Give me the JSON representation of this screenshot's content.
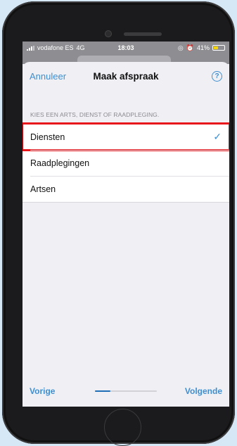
{
  "status_bar": {
    "carrier": "vodafone ES",
    "network": "4G",
    "time": "18:03",
    "battery_percent_label": "41%",
    "battery_level": 0.41,
    "battery_color": "#f5d400"
  },
  "sheet": {
    "cancel_label": "Annuleer",
    "title": "Maak afspraak",
    "help_icon": "question-circle-icon"
  },
  "section": {
    "header": "KIES EEN ARTS, DIENST OF RAADPLEGING.",
    "items": [
      {
        "label": "Diensten",
        "selected": true
      },
      {
        "label": "Raadplegingen",
        "selected": false
      },
      {
        "label": "Artsen",
        "selected": false
      }
    ]
  },
  "footer": {
    "previous_label": "Vorige",
    "next_label": "Volgende",
    "progress_fraction": 0.25
  },
  "colors": {
    "accent": "#3f8fd0",
    "highlight": "#e8171b",
    "background": "#d6e8f5"
  }
}
